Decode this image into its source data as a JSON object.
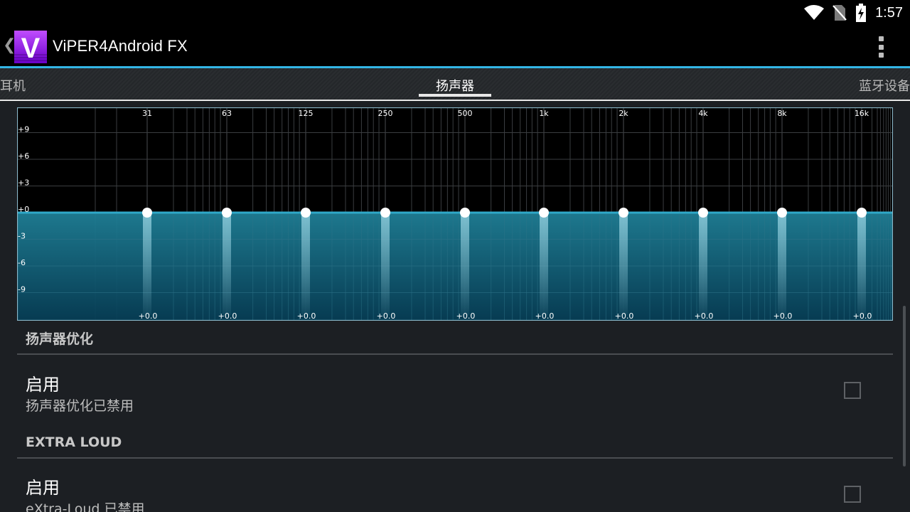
{
  "status_bar": {
    "time": "1:57",
    "icons": [
      "wifi-icon",
      "no-sim-icon",
      "battery-charging-icon"
    ]
  },
  "action_bar": {
    "title": "ViPER4Android FX",
    "logo_letter": "V",
    "up_glyph": "❮",
    "overflow_icon": "overflow-menu-icon"
  },
  "tabs": [
    {
      "label": "耳机",
      "selected": false
    },
    {
      "label": "扬声器",
      "selected": true
    },
    {
      "label": "蓝牙设备",
      "selected": false
    }
  ],
  "equalizer": {
    "y_ticks": [
      "+9",
      "+6",
      "+3",
      "+0",
      "-3",
      "-6",
      "-9"
    ],
    "y_tick_values": [
      9,
      6,
      3,
      0,
      -3,
      -6,
      -9
    ],
    "y_range": [
      -12,
      12
    ],
    "bands": [
      "31",
      "63",
      "125",
      "250",
      "500",
      "1k",
      "2k",
      "4k",
      "8k",
      "16k"
    ],
    "gains": [
      0,
      0,
      0,
      0,
      0,
      0,
      0,
      0,
      0,
      0
    ],
    "gain_labels": [
      "+0.0",
      "+0.0",
      "+0.0",
      "+0.0",
      "+0.0",
      "+0.0",
      "+0.0",
      "+0.0",
      "+0.0",
      "+0.0"
    ],
    "colors": {
      "fill_top": "#1f7f96",
      "fill_bottom": "#073e56",
      "grid": "#3a3d40",
      "knob": "#ffffff",
      "border": "#8ab8c9"
    }
  },
  "sections": [
    {
      "header": "扬声器优化",
      "pref_title": "启用",
      "pref_summary": "扬声器优化已禁用",
      "checked": false
    },
    {
      "header": "EXTRA LOUD",
      "pref_title": "启用",
      "pref_summary": "eXtra-Loud 已禁用",
      "checked": false
    }
  ],
  "colors": {
    "accent": "#33b5e5",
    "logo_purple": "#8a2be2"
  }
}
